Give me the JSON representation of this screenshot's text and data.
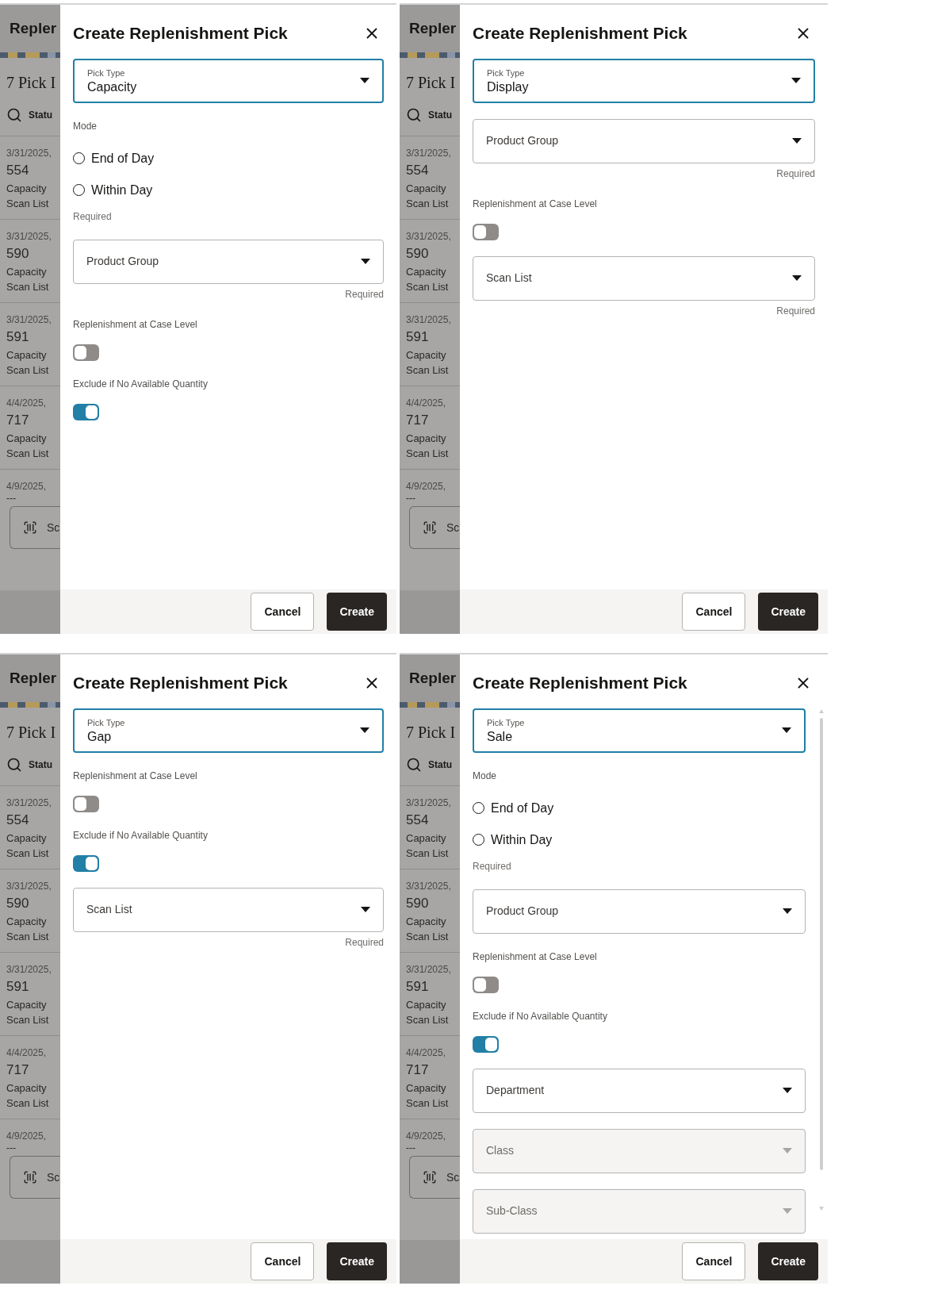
{
  "screens": [
    {
      "background": {
        "header": "Repler",
        "heading": "7 Pick I",
        "filter": "Statu",
        "items": [
          {
            "date": "3/31/2025,",
            "number": "554",
            "type": "Capacity",
            "list": "Scan List"
          },
          {
            "date": "3/31/2025,",
            "number": "590",
            "type": "Capacity",
            "list": "Scan List"
          },
          {
            "date": "3/31/2025,",
            "number": "591",
            "type": "Capacity",
            "list": "Scan List"
          },
          {
            "date": "4/4/2025,",
            "number": "717",
            "type": "Capacity",
            "list": "Scan List"
          }
        ],
        "last_date": "4/9/2025,",
        "last_number": "---",
        "scan_button": "Sc"
      },
      "dialog": {
        "title": "Create Replenishment Pick",
        "scrollbar": false,
        "fields": [
          {
            "kind": "select",
            "label": "Pick Type",
            "value": "Capacity",
            "focused": true,
            "disabled": false
          },
          {
            "kind": "radio",
            "label": "Mode",
            "options": [
              {
                "label": "End of Day",
                "selected": false
              },
              {
                "label": "Within Day",
                "selected": false
              }
            ],
            "note": "Required"
          },
          {
            "kind": "select",
            "label": "Product Group",
            "focused": false,
            "disabled": false,
            "note": "Required"
          },
          {
            "kind": "toggle",
            "label": "Replenishment at Case Level",
            "on": false
          },
          {
            "kind": "toggle",
            "label": "Exclude if No Available Quantity",
            "on": true
          }
        ],
        "buttons": [
          {
            "label": "Cancel",
            "primary": false
          },
          {
            "label": "Create",
            "primary": true
          }
        ]
      }
    },
    {
      "background": {
        "header": "Repler",
        "heading": "7 Pick I",
        "filter": "Statu",
        "items": [
          {
            "date": "3/31/2025,",
            "number": "554",
            "type": "Capacity",
            "list": "Scan List"
          },
          {
            "date": "3/31/2025,",
            "number": "590",
            "type": "Capacity",
            "list": "Scan List"
          },
          {
            "date": "3/31/2025,",
            "number": "591",
            "type": "Capacity",
            "list": "Scan List"
          },
          {
            "date": "4/4/2025,",
            "number": "717",
            "type": "Capacity",
            "list": "Scan List"
          }
        ],
        "last_date": "4/9/2025,",
        "last_number": "---",
        "scan_button": "Sc"
      },
      "dialog": {
        "title": "Create Replenishment Pick",
        "scrollbar": false,
        "fields": [
          {
            "kind": "select",
            "label": "Pick Type",
            "value": "Display",
            "focused": true,
            "disabled": false
          },
          {
            "kind": "select",
            "label": "Product Group",
            "focused": false,
            "disabled": false,
            "note": "Required"
          },
          {
            "kind": "toggle",
            "label": "Replenishment at Case Level",
            "on": false
          },
          {
            "kind": "select",
            "label": "Scan List",
            "focused": false,
            "disabled": false,
            "note": "Required"
          }
        ],
        "buttons": [
          {
            "label": "Cancel",
            "primary": false
          },
          {
            "label": "Create",
            "primary": true
          }
        ]
      }
    },
    {
      "background": {
        "header": "Repler",
        "heading": "7 Pick I",
        "filter": "Statu",
        "items": [
          {
            "date": "3/31/2025,",
            "number": "554",
            "type": "Capacity",
            "list": "Scan List"
          },
          {
            "date": "3/31/2025,",
            "number": "590",
            "type": "Capacity",
            "list": "Scan List"
          },
          {
            "date": "3/31/2025,",
            "number": "591",
            "type": "Capacity",
            "list": "Scan List"
          },
          {
            "date": "4/4/2025,",
            "number": "717",
            "type": "Capacity",
            "list": "Scan List"
          }
        ],
        "last_date": "4/9/2025,",
        "last_number": "---",
        "scan_button": "Sc"
      },
      "dialog": {
        "title": "Create Replenishment Pick",
        "scrollbar": false,
        "fields": [
          {
            "kind": "select",
            "label": "Pick Type",
            "value": "Gap",
            "focused": true,
            "disabled": false
          },
          {
            "kind": "toggle",
            "label": "Replenishment at Case Level",
            "on": false
          },
          {
            "kind": "toggle",
            "label": "Exclude if No Available Quantity",
            "on": true
          },
          {
            "kind": "select",
            "label": "Scan List",
            "focused": false,
            "disabled": false,
            "note": "Required"
          }
        ],
        "buttons": [
          {
            "label": "Cancel",
            "primary": false
          },
          {
            "label": "Create",
            "primary": true
          }
        ]
      }
    },
    {
      "background": {
        "header": "Repler",
        "heading": "7 Pick I",
        "filter": "Statu",
        "items": [
          {
            "date": "3/31/2025,",
            "number": "554",
            "type": "Capacity",
            "list": "Scan List"
          },
          {
            "date": "3/31/2025,",
            "number": "590",
            "type": "Capacity",
            "list": "Scan List"
          },
          {
            "date": "3/31/2025,",
            "number": "591",
            "type": "Capacity",
            "list": "Scan List"
          },
          {
            "date": "4/4/2025,",
            "number": "717",
            "type": "Capacity",
            "list": "Scan List"
          }
        ],
        "last_date": "4/9/2025,",
        "last_number": "---",
        "scan_button": "Sc"
      },
      "dialog": {
        "title": "Create Replenishment Pick",
        "scrollbar": true,
        "fields": [
          {
            "kind": "select",
            "label": "Pick Type",
            "value": "Sale",
            "focused": true,
            "disabled": false
          },
          {
            "kind": "radio",
            "label": "Mode",
            "options": [
              {
                "label": "End of Day",
                "selected": false
              },
              {
                "label": "Within Day",
                "selected": false
              }
            ],
            "note": "Required"
          },
          {
            "kind": "select",
            "label": "Product Group",
            "focused": false,
            "disabled": false
          },
          {
            "kind": "toggle",
            "label": "Replenishment at Case Level",
            "on": false
          },
          {
            "kind": "toggle",
            "label": "Exclude if No Available Quantity",
            "on": true
          },
          {
            "kind": "select",
            "label": "Department",
            "focused": false,
            "disabled": false
          },
          {
            "kind": "select",
            "label": "Class",
            "focused": false,
            "disabled": true
          },
          {
            "kind": "select",
            "label": "Sub-Class",
            "focused": false,
            "disabled": true
          }
        ],
        "buttons": [
          {
            "label": "Cancel",
            "primary": false
          },
          {
            "label": "Create",
            "primary": true
          }
        ]
      }
    }
  ]
}
